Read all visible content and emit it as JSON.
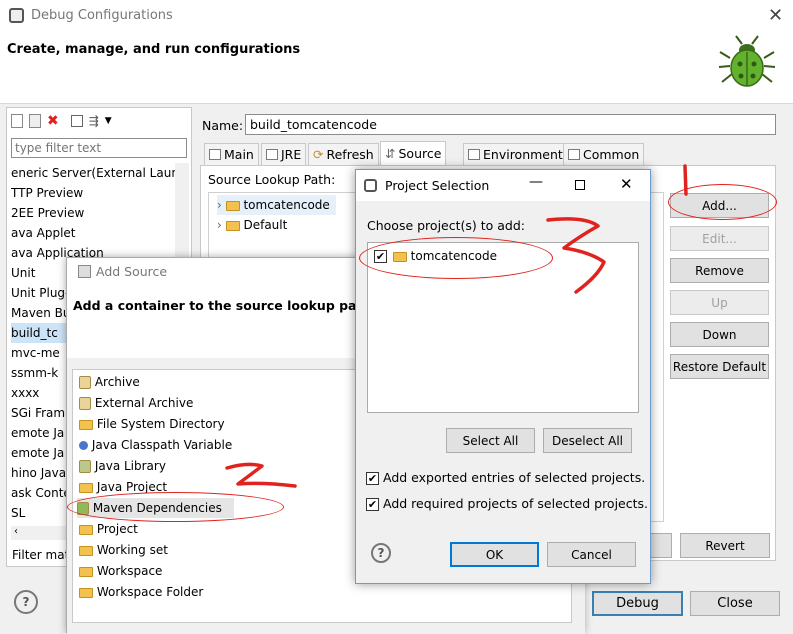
{
  "window": {
    "title": "Debug Configurations",
    "subtitle": "Create, manage, and run configurations"
  },
  "left": {
    "filter_placeholder": "type filter text",
    "items": [
      "eneric Server(External Laun",
      "TTP Preview",
      "2EE Preview",
      "ava Applet",
      "ava Application",
      "Unit",
      "Unit Plug-",
      "Maven Bui",
      "build_tc",
      "mvc-me",
      "ssmm-k",
      "xxxx",
      "SGi Fram",
      "emote Ja",
      "emote Ja",
      "hino Java",
      "ask Conte",
      "SL"
    ],
    "status": "Filter mat"
  },
  "config": {
    "name_label": "Name:",
    "name_value": "build_tomcatencode",
    "tabs": [
      "Main",
      "JRE",
      "Refresh",
      "Source",
      "Environment",
      "Common"
    ],
    "source_label": "Source Lookup Path:",
    "tree": [
      "tomcatencode",
      "Default"
    ],
    "buttons": {
      "add": "Add...",
      "edit": "Edit...",
      "remove": "Remove",
      "up": "Up",
      "down": "Down",
      "restore": "Restore Default"
    },
    "revert": "Revert"
  },
  "footer": {
    "debug": "Debug",
    "close": "Close"
  },
  "add_source": {
    "title": "Add Source",
    "heading": "Add a container to the source lookup path",
    "items": [
      "Archive",
      "External Archive",
      "File System Directory",
      "Java Classpath Variable",
      "Java Library",
      "Java Project",
      "Maven Dependencies",
      "Project",
      "Working set",
      "Workspace",
      "Workspace Folder"
    ]
  },
  "project_selection": {
    "title": "Project Selection",
    "label": "Choose project(s) to add:",
    "project": "tomcatencode",
    "select_all": "Select All",
    "deselect_all": "Deselect All",
    "opt1": "Add exported entries of selected projects.",
    "opt2": "Add required projects of selected projects.",
    "ok": "OK",
    "cancel": "Cancel"
  },
  "colors": {
    "annotation_red": "#e0231e",
    "focus_blue": "#0078d7"
  }
}
